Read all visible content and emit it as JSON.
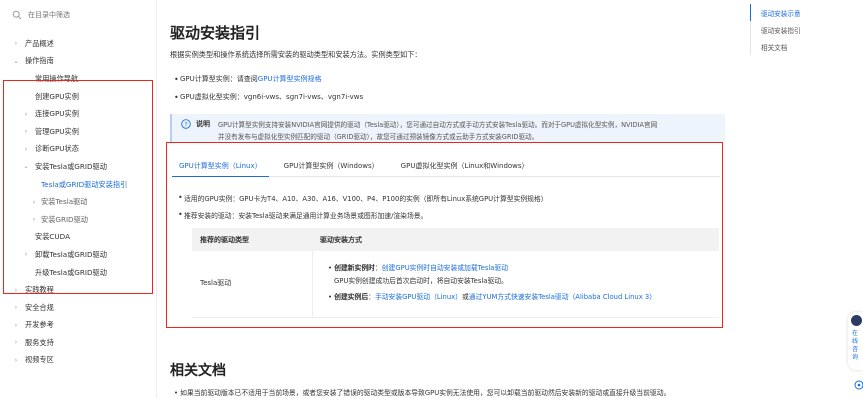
{
  "search": {
    "placeholder": "在目录中筛选"
  },
  "sidebar": {
    "items": [
      {
        "label": "产品概述"
      },
      {
        "label": "操作指南"
      },
      {
        "label": "常用操作导航"
      },
      {
        "label": "创建GPU实例"
      },
      {
        "label": "连接GPU实例"
      },
      {
        "label": "管理GPU实例"
      },
      {
        "label": "诊断GPU状态"
      },
      {
        "label": "安装Tesla或GRID驱动"
      },
      {
        "label": "Tesla或GRID驱动安装指引"
      },
      {
        "label": "安装Tesla驱动"
      },
      {
        "label": "安装GRID驱动"
      },
      {
        "label": "安装CUDA"
      },
      {
        "label": "卸载Tesla或GRID驱动"
      },
      {
        "label": "升级Tesla或GRID驱动"
      },
      {
        "label": "实践教程"
      },
      {
        "label": "安全合规"
      },
      {
        "label": "开发参考"
      },
      {
        "label": "服务支持"
      },
      {
        "label": "视频专区"
      }
    ]
  },
  "main": {
    "title": "驱动安装指引",
    "intro": "根据实例类型和操作系统选择所需安装的驱动类型和安装方法。实例类型如下：",
    "bullets": [
      {
        "prefix": "GPU计算型实例：请查阅",
        "link": "GPU计算型实例规格"
      },
      {
        "text": "GPU虚拟化型实例：vgn6i-vws、sgn7i-vws、vgn7i-vws"
      }
    ],
    "note": {
      "label": "说明",
      "line1": "GPU计算型实例支持安装NVIDIA官网提供的驱动（Tesla驱动），您可通过自动方式或手动方式安装Tesla驱动。而对于GPU虚拟化型实例，NVIDIA官网",
      "line2": "并没有发布与虚拟化型实例匹配的驱动（GRID驱动），故您可通过预装镜像方式或云助手方式安装GRID驱动。"
    },
    "tabs": [
      {
        "label": "GPU计算型实例（Linux）"
      },
      {
        "label": "GPU计算型实例（Windows）"
      },
      {
        "label": "GPU虚拟化型实例（Linux和Windows）"
      }
    ],
    "tab_bullets": [
      "适用的GPU实例：GPU卡为T4、A10、A30、A16、V100、P4、P100的实例（即所有Linux系统GPU计算型实例规格）",
      "推荐安装的驱动：安装Tesla驱动来满足通用计算业务场景或图形加速/渲染场景。"
    ],
    "table": {
      "headers": [
        "推荐的驱动类型",
        "驱动安装方式"
      ],
      "row": {
        "type": "Tesla驱动",
        "new_label": "创建新实例时",
        "new_link": "创建GPU实例时自动安装或加载Tesla驱动",
        "new_note": "GPU实例创建成功后首次启动时，将自动安装Tesla驱动。",
        "created_label": "创建实例后",
        "created_link1": "手动安装GPU驱动（Linux）",
        "created_or": "或",
        "created_link2": "通过YUM方式快速安装Tesla驱动（Alibaba Cloud Linux 3）"
      }
    },
    "related_title": "相关文档",
    "bottom_text": "如果当前驱动版本已不适用于当前场景，或者您安装了错误的驱动类型或版本导致GPU实例无法使用，您可以卸载当前驱动然后安装新的驱动或直接升级当前驱动。"
  },
  "toc": {
    "items": [
      {
        "label": "驱动安装示意"
      },
      {
        "label": "驱动安装指引"
      },
      {
        "label": "相关文档"
      }
    ]
  },
  "float": {
    "text": "在线咨询"
  },
  "colors": {
    "accent": "#1a6ddb",
    "highlight_box": "#e8281f",
    "note_bg": "#eef4fc"
  }
}
